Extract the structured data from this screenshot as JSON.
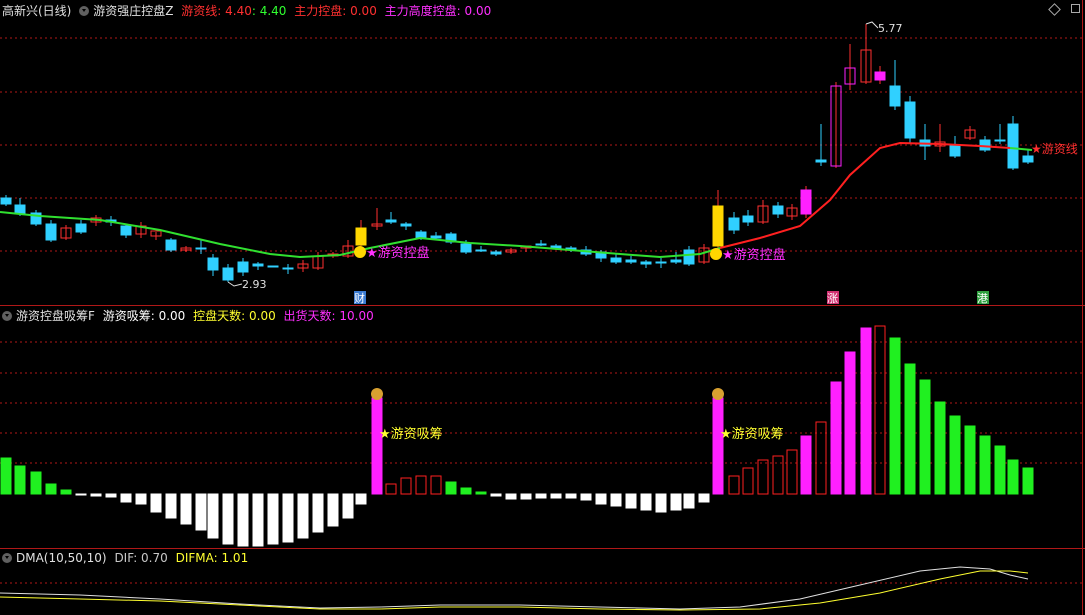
{
  "main_panel": {
    "title": "高新兴(日线)",
    "indicator_name": "游资强庄控盘Z",
    "lines": [
      {
        "label": "游资线: 4.40",
        "color": "#ff3030"
      },
      {
        "label": ": 4.40",
        "color": "#30ff30"
      },
      {
        "label": "主力控盘: 0.00",
        "color": "#ff3030"
      },
      {
        "label": "主力高度控盘: 0.00",
        "color": "#ff30ff"
      }
    ],
    "high_label": "5.77",
    "low_label": "2.93",
    "signal_text": "游资控盘",
    "line_end_label": "游资线",
    "markers": [
      "财",
      "涨",
      "港"
    ]
  },
  "sub_panel": {
    "indicator_name": "游资控盘吸筹F",
    "lines": [
      {
        "label": "游资吸筹: 0.00",
        "color": "#ffffff"
      },
      {
        "label": "控盘天数: 0.00",
        "color": "#ffff30"
      },
      {
        "label": "出货天数: 10.00",
        "color": "#ff30ff"
      }
    ],
    "signal_text": "游资吸筹"
  },
  "dma_panel": {
    "indicator_name": "DMA(10,50,10)",
    "lines": [
      {
        "label": "DIF: 0.70",
        "color": "#c8c8c8"
      },
      {
        "label": "DIFMA: 1.01",
        "color": "#ffff30"
      }
    ]
  },
  "colors": {
    "up": "#ff3030",
    "down": "#30d0ff",
    "ma": "#30e030",
    "ma_up": "#ff2020",
    "hist_green": "#20f020",
    "hist_white": "#ffffff",
    "hist_magenta": "#ff20ff",
    "hist_red": "#ff2020",
    "grid": "#b01818",
    "signal": "#ff30ff"
  }
}
